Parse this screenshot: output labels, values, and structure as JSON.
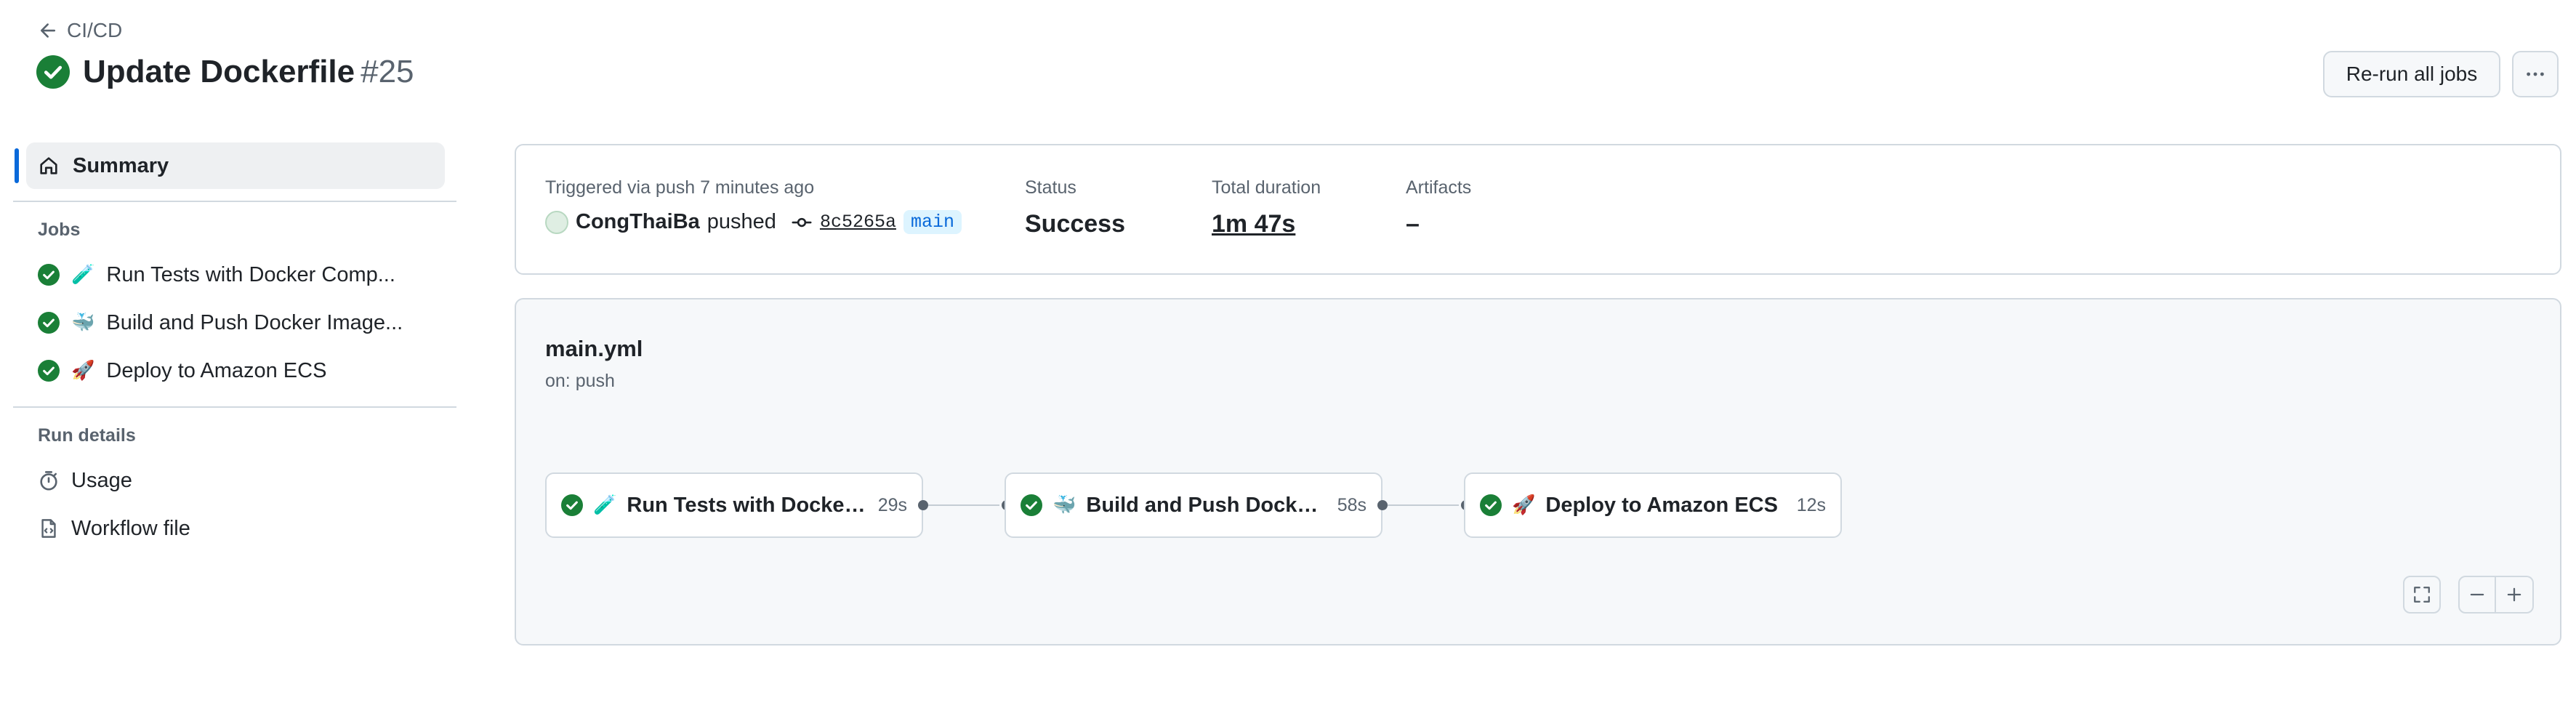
{
  "header": {
    "back_label": "CI/CD",
    "title": "Update Dockerfile",
    "run_number": "#25",
    "rerun_label": "Re-run all jobs",
    "more_icon": "kebab-horizontal-icon"
  },
  "sidebar": {
    "summary_label": "Summary",
    "jobs_heading": "Jobs",
    "jobs": [
      {
        "emoji": "🧪",
        "label": "Run Tests with Docker Comp..."
      },
      {
        "emoji": "🐳",
        "label": "Build and Push Docker Image..."
      },
      {
        "emoji": "🚀",
        "label": "Deploy to Amazon ECS"
      }
    ],
    "run_details_heading": "Run details",
    "usage_label": "Usage",
    "workflow_file_label": "Workflow file"
  },
  "summary": {
    "trigger_label": "Triggered via push 7 minutes ago",
    "actor": "CongThaiBa",
    "action": "pushed",
    "sha": "8c5265a",
    "branch": "main",
    "status_label": "Status",
    "status_value": "Success",
    "duration_label": "Total duration",
    "duration_value": "1m 47s",
    "artifacts_label": "Artifacts",
    "artifacts_value": "–"
  },
  "graph": {
    "workflow_name": "main.yml",
    "trigger": "on: push",
    "jobs": [
      {
        "emoji": "🧪",
        "label": "Run Tests with Docker ...",
        "duration": "29s"
      },
      {
        "emoji": "🐳",
        "label": "Build and Push Docker ...",
        "duration": "58s"
      },
      {
        "emoji": "🚀",
        "label": "Deploy to Amazon ECS",
        "duration": "12s"
      }
    ]
  },
  "colors": {
    "success": "#1a7f37",
    "accent": "#0969da",
    "border": "#d1d9e0"
  }
}
